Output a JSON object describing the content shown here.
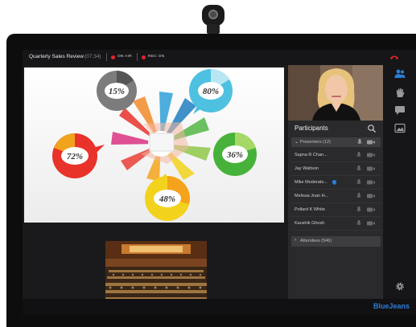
{
  "meeting": {
    "title": "Quarterly Sales Review",
    "duration": "(07:34)",
    "on_air_label": "ON AIR",
    "rec_label": "REC ON"
  },
  "slide": {
    "values": [
      "15%",
      "80%",
      "72%",
      "36%",
      "48%"
    ],
    "colors": [
      "#7c7c7c",
      "#4ec1e0",
      "#e8322a",
      "#47b23a",
      "#f2d21c"
    ]
  },
  "participants": {
    "title": "Participants",
    "presenters_label": "Presenters (12)",
    "presenters": [
      {
        "name": "Sapna R Chan..."
      },
      {
        "name": "Jay Wattson"
      },
      {
        "name": "Mike Moderato..."
      },
      {
        "name": "Melissa Joan H..."
      },
      {
        "name": "Pollard K White"
      },
      {
        "name": "Kaushik Ghosh"
      }
    ],
    "attendees_label": "Attendees (546)"
  },
  "brand": "BlueJeans",
  "icons": {
    "hangup": "phone-hangup-icon",
    "participants": "participants-icon",
    "raise_hand": "hand-icon",
    "chat": "chat-icon",
    "share": "image-share-icon",
    "settings": "gear-icon",
    "search": "search-icon"
  },
  "accent": "#2c7ed6",
  "alert": "#e0262a"
}
